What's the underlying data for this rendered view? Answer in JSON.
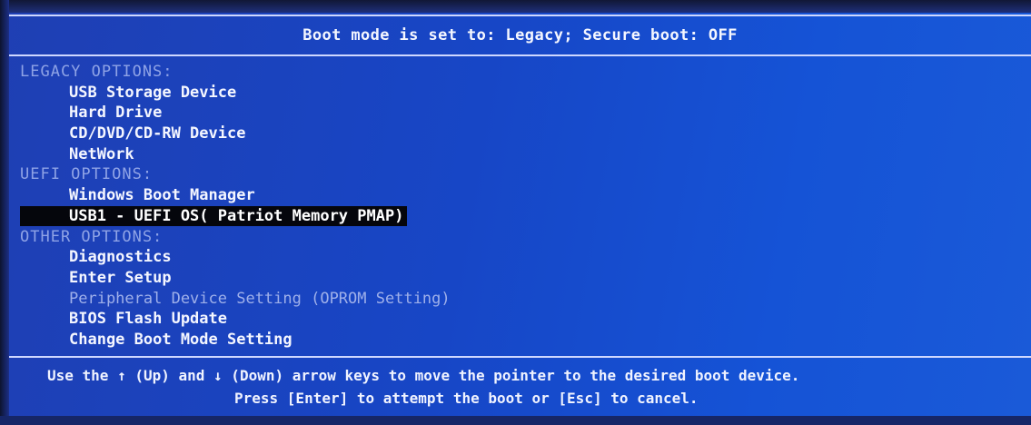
{
  "header": {
    "title": "Boot mode is set to: Legacy; Secure boot: OFF"
  },
  "sections": [
    {
      "label": "LEGACY OPTIONS:",
      "items": [
        {
          "label": "USB Storage Device"
        },
        {
          "label": "Hard Drive"
        },
        {
          "label": "CD/DVD/CD-RW Device"
        },
        {
          "label": "NetWork"
        }
      ]
    },
    {
      "label": "UEFI OPTIONS:",
      "items": [
        {
          "label": "Windows Boot Manager"
        },
        {
          "label": "USB1 - UEFI OS( Patriot Memory PMAP)",
          "selected": true
        }
      ]
    },
    {
      "label": "OTHER OPTIONS:",
      "items": [
        {
          "label": "Diagnostics"
        },
        {
          "label": "Enter Setup"
        },
        {
          "label": "Peripheral Device Setting (OPROM Setting)",
          "disabled": true
        },
        {
          "label": "BIOS Flash Update"
        },
        {
          "label": "Change Boot Mode Setting"
        }
      ]
    }
  ],
  "footer": {
    "line1_a": "Use the ",
    "up_icon": "up-arrow-icon",
    "line1_b": " (Up) and ",
    "down_icon": "down-arrow-icon",
    "line1_c": " (Down) arrow keys to move the pointer to the desired boot device.",
    "line2": "Press [Enter] to attempt the boot or [Esc] to cancel."
  },
  "colors": {
    "background": "#1746c6",
    "section_label": "#8fa3e6",
    "selected_bg": "#05060c",
    "text": "#f4f6ff"
  }
}
